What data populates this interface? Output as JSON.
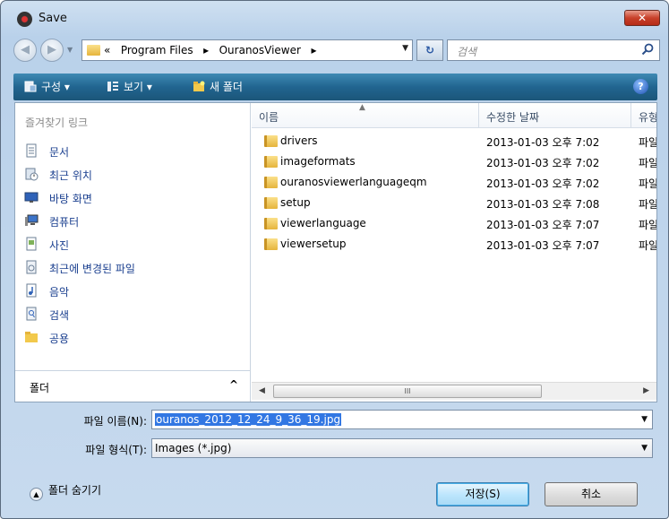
{
  "window": {
    "title": "Save"
  },
  "navbar": {
    "address_prefix": "«",
    "address_segments": [
      "Program Files",
      "OuranosViewer"
    ],
    "address_sep": "▸",
    "search_placeholder": "검색"
  },
  "toolbar": {
    "organize": "구성 ▾",
    "views": "보기 ▾",
    "new_folder": "새 폴더",
    "help": "?"
  },
  "sidebar": {
    "header": "즐겨찾기 링크",
    "items": [
      {
        "label": "문서",
        "icon": "documents-icon"
      },
      {
        "label": "최근 위치",
        "icon": "recent-places-icon"
      },
      {
        "label": "바탕 화면",
        "icon": "desktop-icon"
      },
      {
        "label": "컴퓨터",
        "icon": "computer-icon"
      },
      {
        "label": "사진",
        "icon": "pictures-icon"
      },
      {
        "label": "최근에 변경된 파일",
        "icon": "recently-changed-icon"
      },
      {
        "label": "음악",
        "icon": "music-icon"
      },
      {
        "label": "검색",
        "icon": "searches-icon"
      },
      {
        "label": "공용",
        "icon": "public-icon"
      }
    ],
    "folders_label": "폴더",
    "folders_chevron": "^"
  },
  "filelist": {
    "columns": [
      "이름",
      "수정한 날짜",
      "유형"
    ],
    "rows": [
      {
        "name": "drivers",
        "date": "2013-01-03 오후 7:02",
        "type": "파일"
      },
      {
        "name": "imageformats",
        "date": "2013-01-03 오후 7:02",
        "type": "파일"
      },
      {
        "name": "ouranosviewerlanguageqm",
        "date": "2013-01-03 오후 7:02",
        "type": "파일"
      },
      {
        "name": "setup",
        "date": "2013-01-03 오후 7:08",
        "type": "파일"
      },
      {
        "name": "viewerlanguage",
        "date": "2013-01-03 오후 7:07",
        "type": "파일"
      },
      {
        "name": "viewersetup",
        "date": "2013-01-03 오후 7:07",
        "type": "파일"
      }
    ],
    "scroll_grip": "III"
  },
  "form": {
    "filename_label": "파일 이름(N):",
    "filename_value": "ouranos_2012_12_24_9_36_19.jpg",
    "filetype_label": "파일 형식(T):",
    "filetype_value": "Images (*.jpg)"
  },
  "footer": {
    "hide_folders": "폴더 숨기기",
    "save": "저장(S)",
    "cancel": "취소"
  },
  "colors": {
    "toolbar": "#216590",
    "selection": "#3277e3",
    "link_text": "#1a3f8f"
  }
}
